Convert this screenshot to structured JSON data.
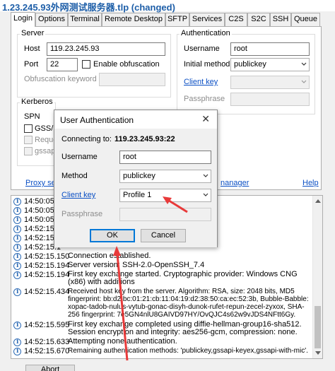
{
  "window": {
    "title": "1.23.245.93外网测试服务器.tlp (changed)"
  },
  "tabs": [
    "Login",
    "Options",
    "Terminal",
    "Remote Desktop",
    "SFTP",
    "Services",
    "C2S",
    "S2C",
    "SSH",
    "Queue"
  ],
  "server": {
    "group_label": "Server",
    "host_label": "Host",
    "host_value": "119.23.245.93",
    "port_label": "Port",
    "port_value": "22",
    "obfuscation_label": "Enable obfuscation",
    "obfuscation_keyword_label": "Obfuscation keyword"
  },
  "kerberos": {
    "group_label": "Kerberos",
    "spn_label": "SPN",
    "gss_label": "GSS/K",
    "request_label": "Reque",
    "gssapi_label": "gssapi-k"
  },
  "authentication": {
    "group_label": "Authentication",
    "username_label": "Username",
    "username_value": "root",
    "method_label": "Initial method",
    "method_value": "publickey",
    "client_key_label": "Client key",
    "passphrase_label": "Passphrase"
  },
  "links": {
    "proxy": "Proxy set",
    "manager": "nanager",
    "help": "Help"
  },
  "dialog": {
    "title": "User Authentication",
    "close": "✕",
    "connecting_label": "Connecting to:",
    "connecting_value": "119.23.245.93:22",
    "username_label": "Username",
    "username_value": "root",
    "method_label": "Method",
    "method_value": "publickey",
    "client_key_label": "Client key",
    "client_key_value": "Profile 1",
    "passphrase_label": "Passphrase",
    "ok_label": "OK",
    "cancel_label": "Cancel"
  },
  "log": [
    {
      "time": "14:50:05.8",
      "msg": ""
    },
    {
      "time": "14:50:05.9",
      "msg": ""
    },
    {
      "time": "14:50:05.9",
      "msg": ""
    },
    {
      "time": "14:52:15.0",
      "msg": ""
    },
    {
      "time": "14:52:15.1",
      "msg": ""
    },
    {
      "time": "14:52:15.1",
      "msg": ""
    },
    {
      "time": "14:52:15.150",
      "msg": "Connection established."
    },
    {
      "time": "14:52:15.194",
      "msg": "Server version: SSH-2.0-OpenSSH_7.4"
    },
    {
      "time": "14:52:15.194",
      "msg": "First key exchange started. Cryptographic provider: Windows CNG (x86) with additions"
    },
    {
      "time": "14:52:15.434",
      "msg": "Received host key from the server. Algorithm: RSA, size: 2048 bits, MD5 fingerprint: bb:d2:bc:01:21:cb:11:04:19:d2:38:50:ca:ec:52:3b, Bubble-Babble: xopac-tadob-nulus-vytub-gonac-disyh-dunok-rufet-repun-zecel-zyxox, SHA-256 fingerprint: 7e5GN4nlU8GAIVD97HY/OvQJC4s62w9vJDS4NFtt6Gy."
    },
    {
      "time": "14:52:15.595",
      "msg": "First key exchange completed using diffie-hellman-group16-sha512. Session encryption and integrity: aes256-gcm, compression: none."
    },
    {
      "time": "14:52:15.633",
      "msg": "Attempting none authentication."
    },
    {
      "time": "14:52:15.670",
      "msg": "Remaining authentication methods: 'publickey,gssapi-keyex,gssapi-with-mic'."
    }
  ],
  "bottom": {
    "button1": "Abort"
  },
  "colors": {
    "accent": "#0078d7",
    "arrow": "#e83a3a",
    "link": "#0a4fc4"
  }
}
